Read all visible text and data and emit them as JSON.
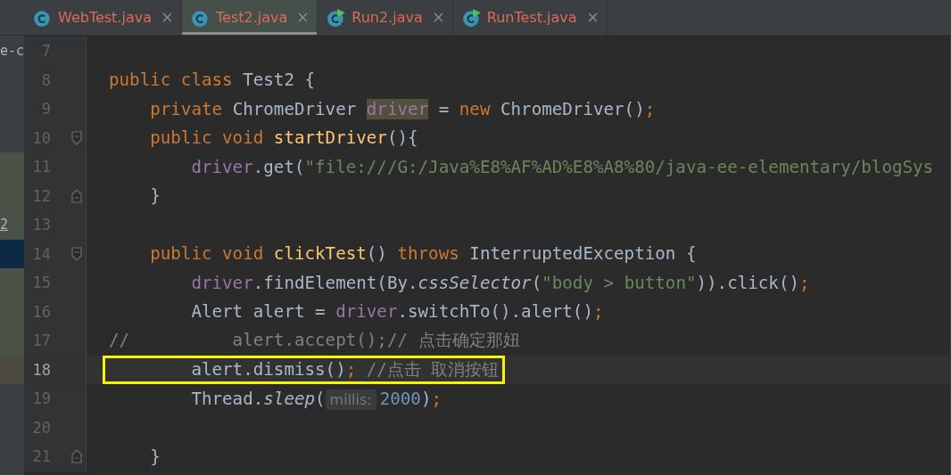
{
  "tabs": [
    {
      "label": "WebTest.java",
      "kind": "class",
      "selected": false
    },
    {
      "label": "Test2.java",
      "kind": "class",
      "selected": true
    },
    {
      "label": "Run2.java",
      "kind": "runnable",
      "selected": false
    },
    {
      "label": "RunTest.java",
      "kind": "runnable",
      "selected": false
    }
  ],
  "project_panel": {
    "rows": [
      {
        "text": "e-c",
        "kind": "plain"
      },
      {
        "kind": "plain"
      },
      {
        "kind": "plain"
      },
      {
        "kind": "plain"
      },
      {
        "kind": "changed"
      },
      {
        "kind": "changed"
      },
      {
        "text": "2",
        "kind": "changed"
      },
      {
        "kind": "selected"
      },
      {
        "kind": "changed"
      },
      {
        "kind": "changed"
      },
      {
        "kind": "changed"
      },
      {
        "kind": "modified"
      },
      {
        "kind": "plain"
      },
      {
        "kind": "plain"
      },
      {
        "kind": "plain"
      }
    ]
  },
  "editor": {
    "lines": [
      {
        "number": "7"
      },
      {
        "number": "8",
        "tokens": [
          {
            "t": "public class ",
            "kind": "kw"
          },
          {
            "t": "Test2 {",
            "kind": "plain"
          }
        ]
      },
      {
        "number": "9",
        "tokens": [
          {
            "t": "    private ",
            "kind": "kw"
          },
          {
            "t": "ChromeDriver ",
            "kind": "plain"
          },
          {
            "t": "driver",
            "kind": "field-hl"
          },
          {
            "t": " = ",
            "kind": "plain"
          },
          {
            "t": "new ",
            "kind": "kw"
          },
          {
            "t": "ChromeDriver()",
            "kind": "plain"
          },
          {
            "t": ";",
            "kind": "kw"
          }
        ]
      },
      {
        "number": "10",
        "fold_start": true,
        "tokens": [
          {
            "t": "    public void ",
            "kind": "kw"
          },
          {
            "t": "startDriver",
            "kind": "method"
          },
          {
            "t": "(){",
            "kind": "plain"
          }
        ]
      },
      {
        "number": "11",
        "tokens": [
          {
            "t": "        driver",
            "kind": "field"
          },
          {
            "t": ".get(",
            "kind": "plain"
          },
          {
            "t": "\"file:///G:/Java%E8%AF%AD%E8%A8%80/java-ee-elementary/blogSys",
            "kind": "str"
          }
        ]
      },
      {
        "number": "12",
        "fold_end": true,
        "tokens": [
          {
            "t": "    }",
            "kind": "plain"
          }
        ]
      },
      {
        "number": "13"
      },
      {
        "number": "14",
        "fold_start": true,
        "tokens": [
          {
            "t": "    public void ",
            "kind": "kw"
          },
          {
            "t": "clickTest",
            "kind": "method"
          },
          {
            "t": "() ",
            "kind": "plain"
          },
          {
            "t": "throws ",
            "kind": "kw"
          },
          {
            "t": "InterruptedException {",
            "kind": "plain"
          }
        ]
      },
      {
        "number": "15",
        "tokens": [
          {
            "t": "        driver",
            "kind": "field"
          },
          {
            "t": ".findElement(By.",
            "kind": "plain"
          },
          {
            "t": "cssSelector",
            "kind": "italic"
          },
          {
            "t": "(",
            "kind": "plain"
          },
          {
            "t": "\"body > button\"",
            "kind": "str"
          },
          {
            "t": ")).click()",
            "kind": "plain"
          },
          {
            "t": ";",
            "kind": "kw"
          }
        ]
      },
      {
        "number": "16",
        "tokens": [
          {
            "t": "        Alert alert = ",
            "kind": "plain"
          },
          {
            "t": "driver",
            "kind": "field"
          },
          {
            "t": ".switchTo().alert()",
            "kind": "plain"
          },
          {
            "t": ";",
            "kind": "kw"
          }
        ]
      },
      {
        "number": "17",
        "tokens": [
          {
            "t": "//          alert.accept();// 点击确定那妞",
            "kind": "comment"
          }
        ]
      },
      {
        "number": "18",
        "current": true,
        "boxed": true,
        "tokens": [
          {
            "t": "        alert.dismiss()",
            "kind": "plain"
          },
          {
            "t": "; ",
            "kind": "kw"
          },
          {
            "t": "//点击 取消按钮",
            "kind": "comment"
          }
        ]
      },
      {
        "number": "19",
        "tokens": [
          {
            "t": "        Thread.",
            "kind": "plain"
          },
          {
            "t": "sleep",
            "kind": "italic"
          },
          {
            "t": "(",
            "kind": "plain"
          },
          {
            "t": "millis:",
            "kind": "hint"
          },
          {
            "t": "2000",
            "kind": "num"
          },
          {
            "t": ")",
            "kind": "plain"
          },
          {
            "t": ";",
            "kind": "kw"
          }
        ]
      },
      {
        "number": "20"
      },
      {
        "number": "21",
        "fold_end": true,
        "tokens": [
          {
            "t": "    }",
            "kind": "plain"
          }
        ]
      }
    ]
  }
}
